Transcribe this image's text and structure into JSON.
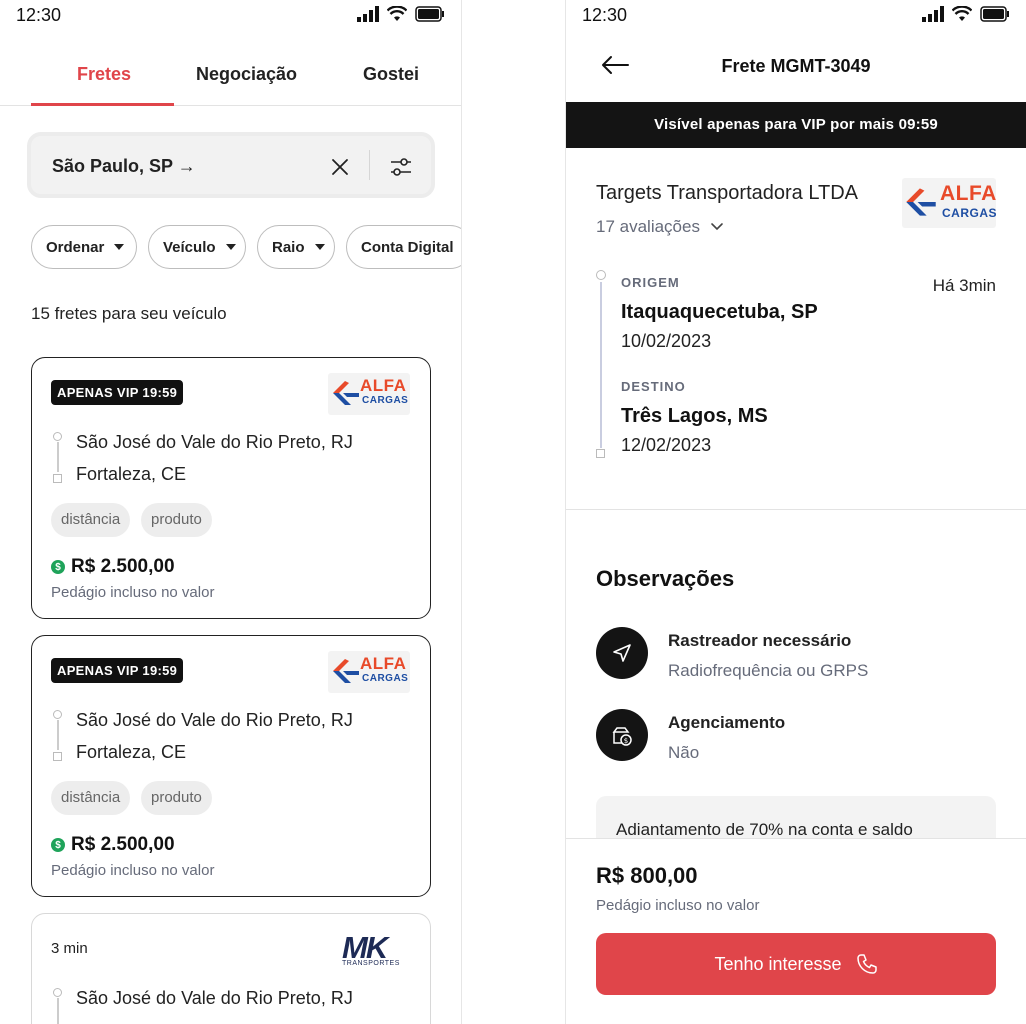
{
  "left": {
    "status": {
      "time": "12:30"
    },
    "tabs": [
      {
        "label": "Fretes",
        "active": true
      },
      {
        "label": "Negociação",
        "active": false
      },
      {
        "label": "Gostei",
        "active": false
      }
    ],
    "search": {
      "value": "São Paulo, SP →",
      "clear_icon": "close-icon",
      "filter_icon": "sliders-icon"
    },
    "chips": [
      {
        "label": "Ordenar"
      },
      {
        "label": "Veículo"
      },
      {
        "label": "Raio"
      },
      {
        "label": "Conta Digital"
      }
    ],
    "result_count": "15 fretes para seu veículo",
    "cards": [
      {
        "badge": "APENAS VIP 19:59",
        "logo": {
          "word": "ALFA",
          "sub": "CARGAS"
        },
        "origin": "São José do Vale do Rio Preto, RJ",
        "destination": "Fortaleza, CE",
        "tags": [
          "distância",
          "produto"
        ],
        "price": "R$ 2.500,00",
        "price_icon": "$",
        "toll": "Pedágio incluso no valor"
      },
      {
        "badge": "APENAS VIP 19:59",
        "logo": {
          "word": "ALFA",
          "sub": "CARGAS"
        },
        "origin": "São José do Vale do Rio Preto, RJ",
        "destination": "Fortaleza, CE",
        "tags": [
          "distância",
          "produto"
        ],
        "price": "R$ 2.500,00",
        "price_icon": "$",
        "toll": "Pedágio incluso no valor"
      },
      {
        "time": "3 min",
        "logo": {
          "word": "MK",
          "sub": "TRANSPORTES"
        },
        "origin": "São José do Vale do Rio Preto, RJ"
      }
    ]
  },
  "right": {
    "status": {
      "time": "12:30"
    },
    "header": {
      "title": "Frete MGMT-3049",
      "back_icon": "arrow-left-icon"
    },
    "vip_banner": "Visível apenas para VIP por mais 09:59",
    "company": {
      "name": "Targets Transportadora LTDA",
      "reviews": "17 avaliações",
      "logo": {
        "word": "ALFA",
        "sub": "CARGAS"
      }
    },
    "route": {
      "origin_label": "ORIGEM",
      "origin_city": "Itaquaquecetuba, SP",
      "origin_date": "10/02/2023",
      "destination_label": "DESTINO",
      "destination_city": "Três Lagos, MS",
      "destination_date": "12/02/2023",
      "posted": "Há 3min"
    },
    "observations": {
      "title": "Observações",
      "items": [
        {
          "label": "Rastreador necessário",
          "value": "Radiofrequência ou GRPS",
          "icon": "navigation-icon"
        },
        {
          "label": "Agenciamento",
          "value": "Não",
          "icon": "money-bag-icon"
        }
      ],
      "note": "Adiantamento de 70% na conta e saldo"
    },
    "footer": {
      "price": "R$ 800,00",
      "toll": "Pedágio incluso no valor",
      "cta": "Tenho interesse",
      "cta_icon": "phone-icon"
    }
  },
  "colors": {
    "accent": "#e0454a",
    "dark": "#141414",
    "money": "#1fa35a",
    "muted": "#666b7a"
  }
}
